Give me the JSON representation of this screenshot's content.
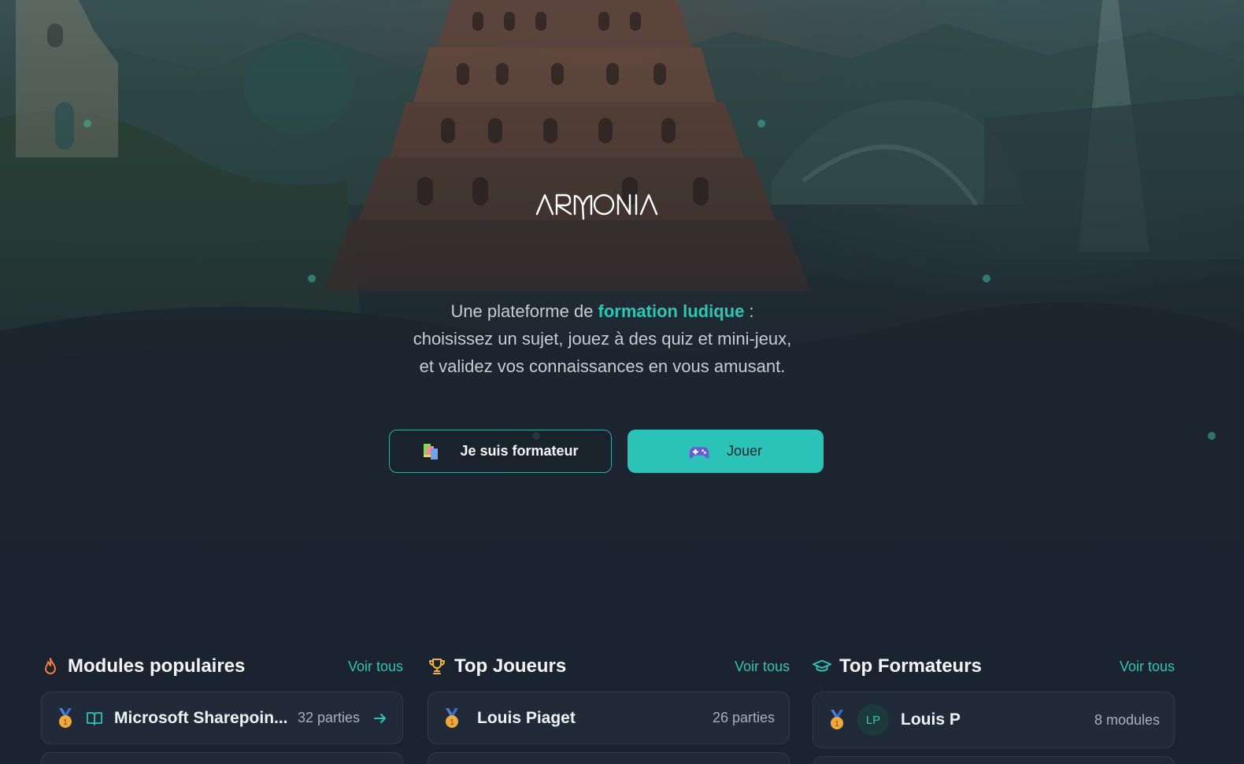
{
  "brand": {
    "logo_text": "ARMONIA"
  },
  "hero": {
    "tagline_line1_prefix": "Une plateforme de ",
    "tagline_accent": "formation ludique",
    "tagline_line1_suffix": " :",
    "tagline_line2": "choisissez un sujet, jouez à des quiz et mini-jeux,",
    "tagline_line3": "et validez vos connaissances en vous amusant.",
    "accent_color": "#2ec4b6"
  },
  "actions": {
    "formateur_label": "Je suis formateur",
    "formateur_icon": "books-icon",
    "jouer_label": "Jouer",
    "jouer_icon": "gamepad-icon",
    "jouer_color": "#2bc3b7"
  },
  "sections": {
    "modules": {
      "title": "Modules populaires",
      "icon": "flame-icon",
      "see_all": "Voir tous",
      "items": [
        {
          "rank_icon": "medal-icon",
          "type_icon": "book-icon",
          "name": "Microsoft Sharepoin...",
          "count": "32 parties"
        }
      ]
    },
    "joueurs": {
      "title": "Top Joueurs",
      "icon": "trophy-icon",
      "see_all": "Voir tous",
      "items": [
        {
          "rank_icon": "medal-icon",
          "name": "Louis Piaget",
          "count": "26 parties"
        }
      ]
    },
    "formateurs": {
      "title": "Top Formateurs",
      "icon": "graduation-cap-icon",
      "see_all": "Voir tous",
      "items": [
        {
          "rank_icon": "medal-icon",
          "initials": "LP",
          "name": "Louis P",
          "count": "8 modules"
        }
      ]
    }
  }
}
